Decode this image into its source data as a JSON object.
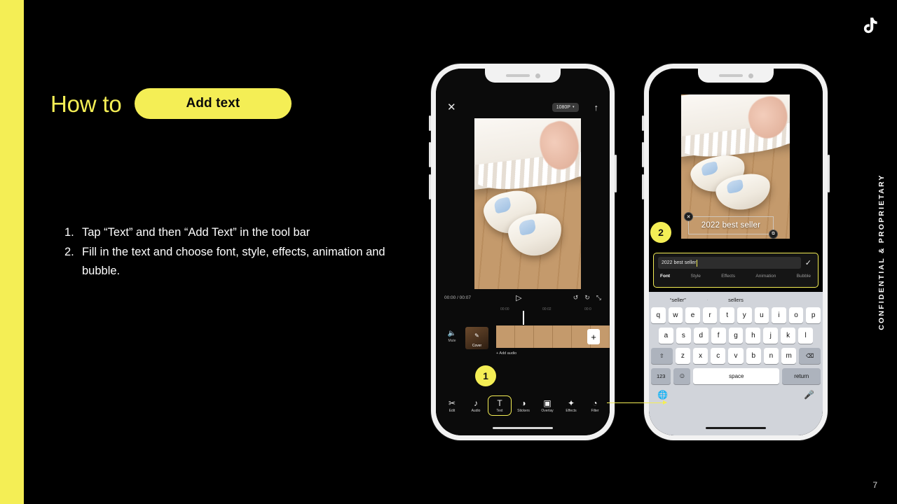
{
  "slide": {
    "page_number": "7",
    "confidential": "CONFIDENTIAL & PROPRIETARY",
    "accent_yellow": "#F4EE55",
    "background": "#000000",
    "logo_icon": "tiktok-note-icon"
  },
  "header": {
    "how_to": "How to",
    "pill_label": "Add text"
  },
  "steps": [
    {
      "num": "1.",
      "text": "Tap “Text” and then “Add Text” in the tool bar"
    },
    {
      "num": "2.",
      "text": "Fill in the text and choose font, style, effects, animation and bubble."
    }
  ],
  "annotations": {
    "badge_one": "1",
    "badge_two": "2"
  },
  "phone1": {
    "topbar": {
      "close_icon": "close-icon",
      "resolution": "1080P",
      "caret": "▾",
      "export_icon": "upload-icon"
    },
    "controls": {
      "time": "00:00 / 00:07",
      "play_icon": "▷",
      "undo_icon": "↺",
      "redo_icon": "↻",
      "fullscreen_icon": "⤡"
    },
    "ruler": [
      "00:00",
      "00:02",
      "00:0"
    ],
    "track": {
      "mute_label": "Mute",
      "mute_icon": "speaker-mute-icon",
      "cover_label": "Cover",
      "cover_icon": "pencil-icon",
      "add_clip_label": "+",
      "add_audio_label": "+ Add audio"
    },
    "tools": [
      {
        "label": "Edit",
        "icon": "✂",
        "active": false
      },
      {
        "label": "Audio",
        "icon": "♪",
        "active": false
      },
      {
        "label": "Text",
        "icon": "T",
        "active": true
      },
      {
        "label": "Stickers",
        "icon": "◑",
        "active": false
      },
      {
        "label": "Overlay",
        "icon": "▣",
        "active": false
      },
      {
        "label": "Effects",
        "icon": "✦",
        "active": false
      },
      {
        "label": "Filter",
        "icon": "◔",
        "active": false
      }
    ]
  },
  "phone2": {
    "overlay": {
      "text": "2022 best seller",
      "delete_icon": "✕",
      "resize_icon": "⧉"
    },
    "text_panel": {
      "input_value": "2022 best seller",
      "confirm_icon": "✓",
      "tabs": [
        {
          "label": "Font",
          "active": true
        },
        {
          "label": "Style",
          "active": false
        },
        {
          "label": "Effects",
          "active": false
        },
        {
          "label": "Animation",
          "active": false
        },
        {
          "label": "Bubble",
          "active": false
        }
      ]
    },
    "keyboard": {
      "predictions": [
        "“seller”",
        "sellers",
        ""
      ],
      "row1": [
        "q",
        "w",
        "e",
        "r",
        "t",
        "y",
        "u",
        "i",
        "o",
        "p"
      ],
      "row2": [
        "a",
        "s",
        "d",
        "f",
        "g",
        "h",
        "j",
        "k",
        "l"
      ],
      "row3": [
        "z",
        "x",
        "c",
        "v",
        "b",
        "n",
        "m"
      ],
      "shift_icon": "⇧",
      "backspace_icon": "⌫",
      "numbers_label": "123",
      "emoji_icon": "☺",
      "space_label": "space",
      "return_label": "return",
      "globe_icon": "⊕",
      "mic_icon": "⭔"
    }
  }
}
